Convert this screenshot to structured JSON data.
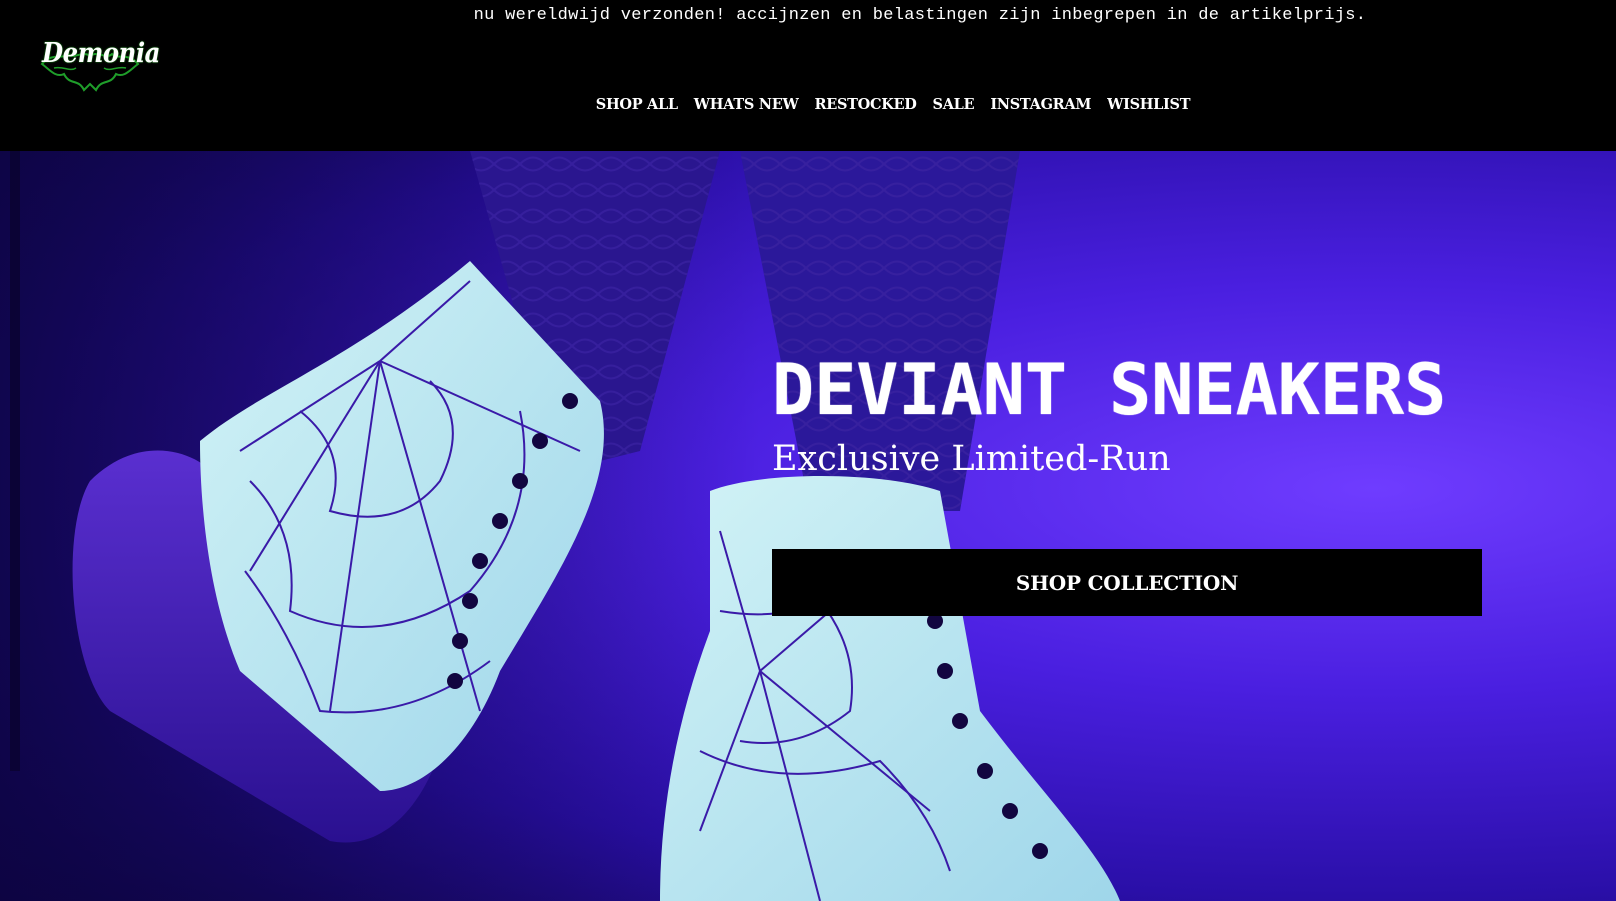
{
  "announcement": "nu wereldwijd verzonden! accijnzen en belastingen zijn inbegrepen in de artikelprijs.",
  "brand": {
    "name": "Demonia",
    "logo_icon": "demonia-bat-wing-logo",
    "accent": "#1f9e2a"
  },
  "nav": {
    "items": [
      {
        "label": "SHOP ALL"
      },
      {
        "label": "WHATS NEW"
      },
      {
        "label": "RESTOCKED"
      },
      {
        "label": "SALE"
      },
      {
        "label": "INSTAGRAM"
      },
      {
        "label": "WISHLIST"
      }
    ]
  },
  "hero": {
    "title": "DEVIANT SNEAKERS",
    "subtitle": "Exclusive Limited-Run",
    "cta_label": "SHOP COLLECTION",
    "image_subject": "spider-web-boots-photo",
    "colors": {
      "background": "#4a1fe0",
      "boot": "#bfe6f0",
      "button": "#000000",
      "text": "#ffffff"
    }
  }
}
